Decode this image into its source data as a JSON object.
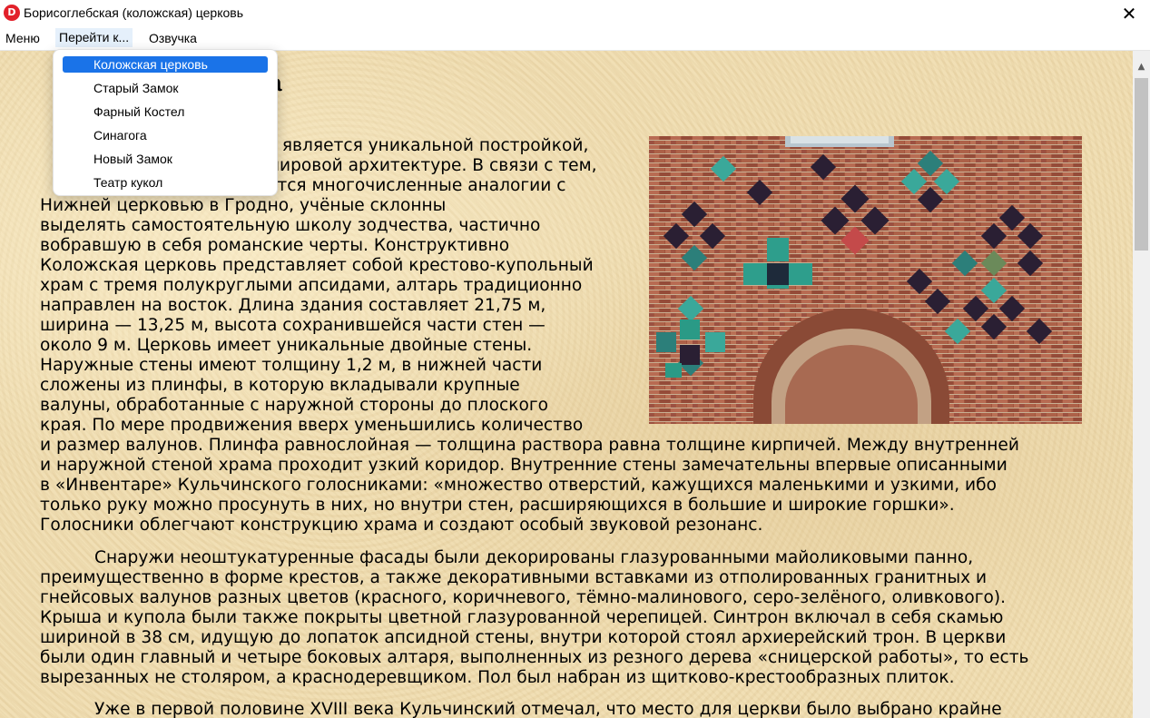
{
  "window": {
    "title": "Борисоглебская (коложская) церковь",
    "app_icon_letter": "D"
  },
  "menubar": {
    "items": [
      "Меню",
      "Перейти к...",
      "Озвучка"
    ]
  },
  "dropdown": {
    "items": [
      "Коложская церковь",
      "Старый Замок",
      "Фарный Костел",
      "Синагога",
      "Новый Замок",
      "Театр кукол"
    ],
    "selected": "Коложская церковь"
  },
  "page": {
    "title_fragment": "а",
    "paragraph1_lines": [
      "ь является уникальной постройкой,",
      "мировой архитектуре. В связи с тем,",
      "отся многочисленные аналогии с",
      "Нижней церковью в Гродно, учёные склонны",
      "выделять самостоятельную школу зодчества, частично",
      "вобравшую в себя романские черты. Конструктивно",
      "Коложская церковь представляет собой крестово-купольный",
      "храм с тремя полукруглыми апсидами, алтарь традиционно",
      "направлен на восток. Длина здания составляет 21,75 м,",
      "ширина — 13,25 м, высота сохранившейся части стен —",
      "около 9 м. Церковь имеет уникальные двойные стены.",
      "Наружные стены имеют толщину 1,2 м, в нижней части",
      "сложены из плинфы, в которую вкладывали крупные",
      "валуны, обработанные с наружной стороны до плоского",
      "края. По мере продвижения вверх уменьшились количество",
      "и размер валунов. Плинфа равнослойная — толщина раствора равна толщине кирпичей. Между внутренней",
      "и наружной стеной храма проходит узкий коридор. Внутренние стены замечательны впервые описанными",
      "в «Инвентаре» Кульчинского голосниками: «множество отверстий, кажущихся маленькими и узкими, ибо",
      "только руку можно просунуть в них, но внутри стен, расширяющихся в большие и широкие горшки».",
      "Голосники облегчают конструкцию храма и создают особый звуковой резонанс."
    ],
    "paragraph2_lines": [
      "Снаружи неоштукатуренные фасады были декорированы глазурованными майоликовыми панно,",
      "преимущественно в форме крестов, а также декоративными вставками из отполированных гранитных и",
      "гнейсовых валунов разных цветов (красного, коричневого, тёмно-малинового, серо-зелёного, оливкового).",
      "Крыша и купола были также покрыты цветной глазурованной черепицей. Синтрон включал в себя скамью",
      "шириной в 38 см, идущую до лопаток апсидной стены, внутри которой стоял архиерейский трон. В церкви",
      "были один главный и четыре боковых алтаря, выполненных из резного дерева «сницерской работы», то есть",
      "вырезанных не столяром, а краснодеревщиком. Пол был набран из щитково-крестообразных плиток."
    ],
    "paragraph3_lines": [
      "Уже в первой половине XVIII века Кульчинский отмечал, что место для церкви было выбрано крайне"
    ]
  },
  "colors": {
    "accent": "#1a73e8",
    "app_icon": "#e2202a",
    "parchment": "#efdcb0"
  },
  "icons": {
    "app": "app-logo-icon",
    "close": "close-icon",
    "scroll_up": "scroll-up-arrow-icon"
  }
}
